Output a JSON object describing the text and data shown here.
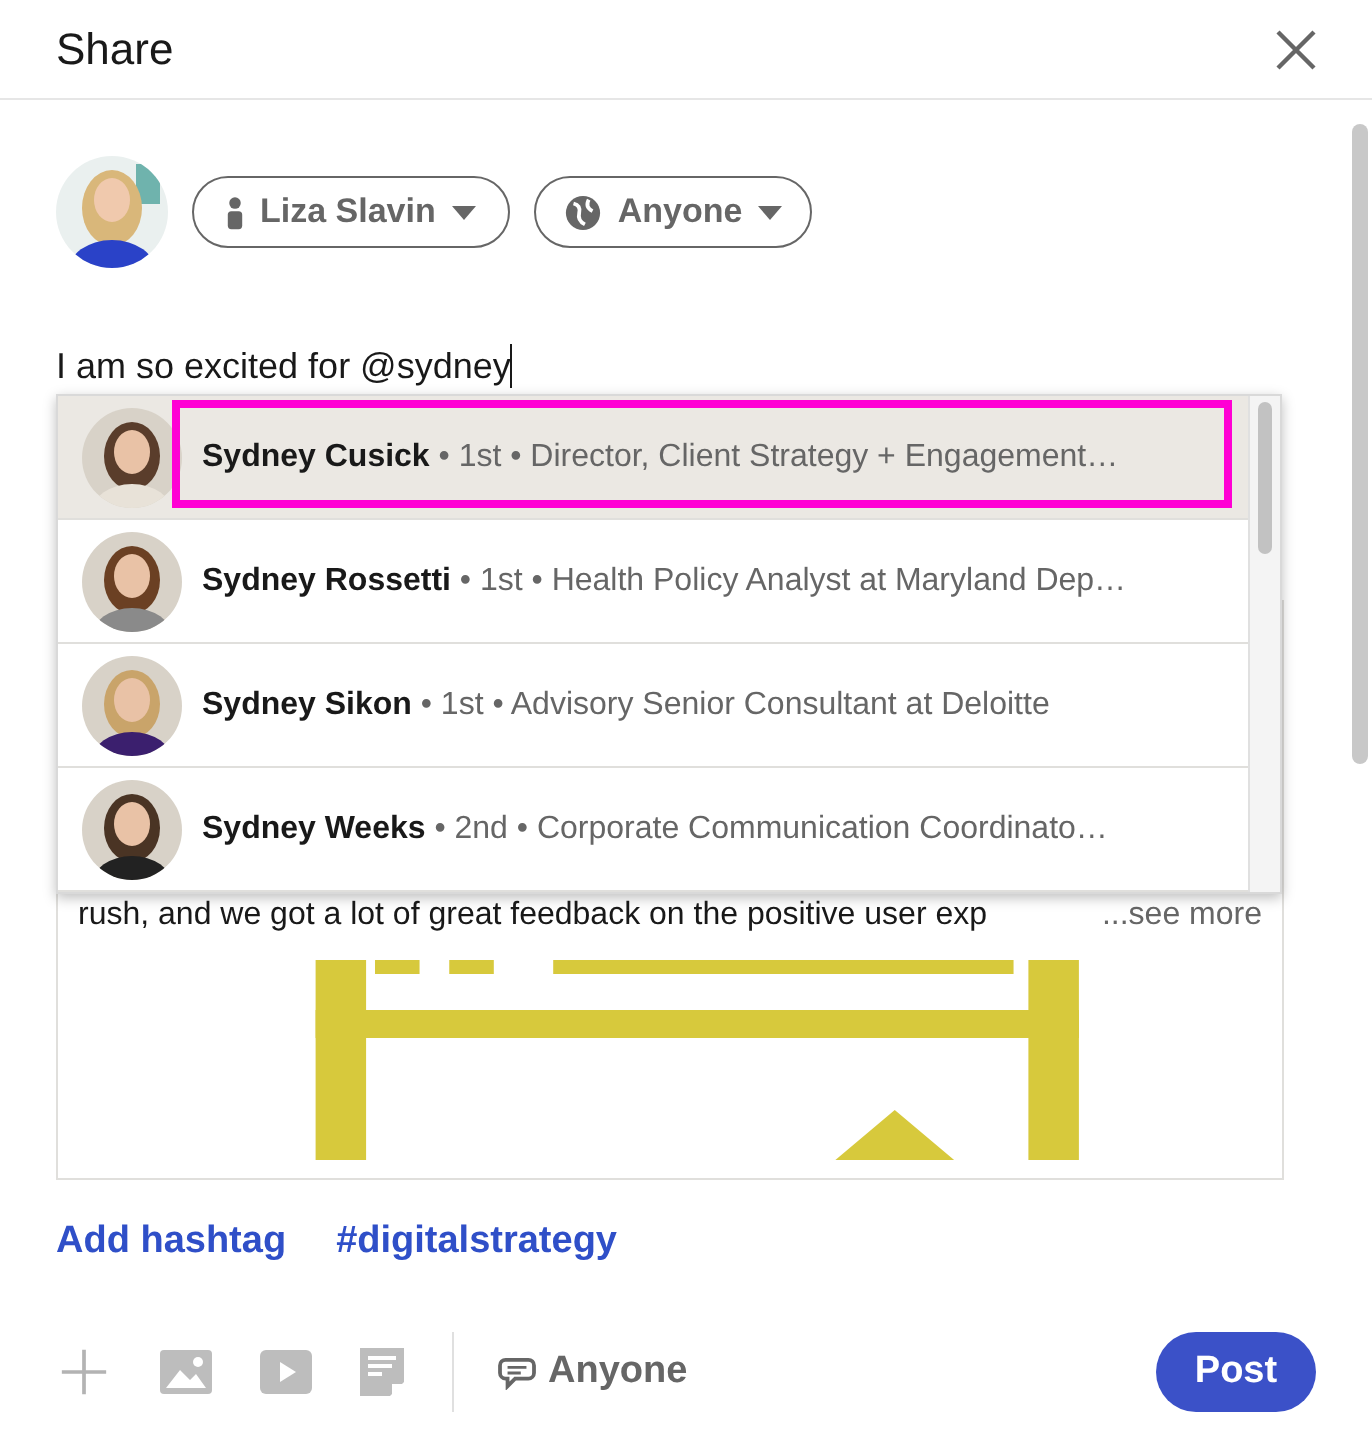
{
  "window": {
    "title": "Share"
  },
  "author": {
    "name": "Liza Slavin",
    "audience": "Anyone"
  },
  "composer": {
    "value": "I am so excited for @sydney"
  },
  "mention_suggestions": [
    {
      "name": "Sydney Cusick",
      "details": "• 1st • Director, Client Strategy + Engagement…",
      "selected": true,
      "highlighted": true
    },
    {
      "name": "Sydney Rossetti",
      "details": "• 1st • Health Policy Analyst at Maryland Dep…",
      "selected": false,
      "highlighted": false
    },
    {
      "name": "Sydney Sikon",
      "details": "• 1st • Advisory Senior Consultant at Deloitte",
      "selected": false,
      "highlighted": false
    },
    {
      "name": "Sydney Weeks",
      "details": "• 2nd • Corporate Communication Coordinato…",
      "selected": false,
      "highlighted": false
    }
  ],
  "shared_post": {
    "text": "rush, and we got a lot of great feedback on the positive user exp",
    "see_more": "...see more"
  },
  "hashtags": [
    "Add hashtag",
    "#digitalstrategy"
  ],
  "footer": {
    "comment_audience": "Anyone",
    "post_button": "Post"
  }
}
